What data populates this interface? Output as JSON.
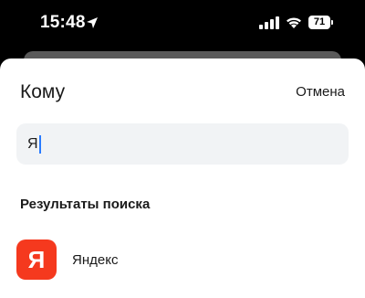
{
  "status_bar": {
    "time": "15:48",
    "battery_level": "71",
    "icons": [
      "location-arrow-icon",
      "cellular-signal-icon",
      "wifi-icon",
      "battery-icon"
    ]
  },
  "sheet": {
    "title": "Кому",
    "cancel_label": "Отмена"
  },
  "search": {
    "value": "Я"
  },
  "results": {
    "section_label": "Результаты поиска",
    "items": [
      {
        "name": "Яндекс",
        "logo_text": "Я",
        "logo_color": "#f5391e"
      }
    ]
  },
  "colors": {
    "accent_caret": "#2a7bff",
    "search_bg": "#f1f3f5"
  }
}
